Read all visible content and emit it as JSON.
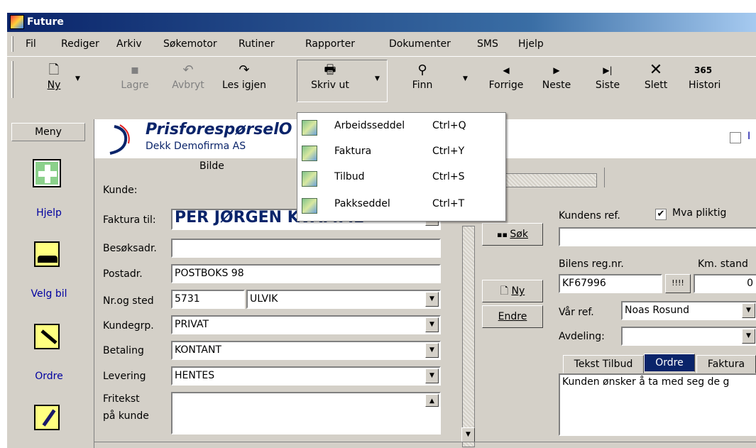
{
  "window": {
    "title": "Future"
  },
  "menu": [
    "Fil",
    "Rediger",
    "Arkiv",
    "Søkemotor",
    "Rutiner",
    "Rapporter",
    "Dokumenter",
    "SMS",
    "Hjelp"
  ],
  "toolbar": {
    "ny": "Ny",
    "lagre": "Lagre",
    "avbryt": "Avbryt",
    "les_igjen": "Les igjen",
    "skriv_ut": "Skriv ut",
    "finn": "Finn",
    "forrige": "Forrige",
    "neste": "Neste",
    "siste": "Siste",
    "slett": "Slett",
    "historikk": "Histori",
    "historikk_badge": "365"
  },
  "print_menu": [
    {
      "label": "Arbeidsseddel",
      "shortcut": "Ctrl+Q"
    },
    {
      "label": "Faktura",
      "shortcut": "Ctrl+Y"
    },
    {
      "label": "Tilbud",
      "shortcut": "Ctrl+S"
    },
    {
      "label": "Pakkseddel",
      "shortcut": "Ctrl+T"
    }
  ],
  "left_nav": {
    "meny": "Meny",
    "hjelp": "Hjelp",
    "velg_bil": "Velg bil",
    "ordre": "Ordre"
  },
  "header": {
    "title": "PrisforespørselO",
    "company": "Dekk Demofirma AS",
    "checkbox_label": "I"
  },
  "form": {
    "bilde": "Bilde",
    "kunde_label": "Kunde:",
    "faktura_til_label": "Faktura til:",
    "faktura_til_value": "PER JØRGEN KVAMME",
    "besoksadr_label": "Besøksadr.",
    "besoksadr_value": "",
    "postadr_label": "Postadr.",
    "postadr_value": "POSTBOKS 98",
    "nr_sted_label": "Nr.og sted",
    "postnr_value": "5731",
    "sted_value": "ULVIK",
    "kundegrp_label": "Kundegrp.",
    "kundegrp_value": "PRIVAT",
    "betaling_label": "Betaling",
    "betaling_value": "KONTANT",
    "levering_label": "Levering",
    "levering_value": "HENTES",
    "fritekst_label_1": "Fritekst",
    "fritekst_label_2": "på kunde"
  },
  "buttons": {
    "sok": "Søk",
    "ny": "Ny",
    "endre": "Endre"
  },
  "right": {
    "kundens_ref_label": "Kundens ref.",
    "mva_label": "Mva pliktig",
    "mva_checked": true,
    "bilens_reg_label": "Bilens reg.nr.",
    "km_stand_label": "Km. stand",
    "reg_value": "KF67996",
    "reg_btn": "!!!!",
    "km_value": "0",
    "var_ref_label": "Vår ref.",
    "var_ref_value": "Noas Rosund",
    "avdeling_label": "Avdeling:",
    "tabs": [
      "Tekst Tilbud",
      "Ordre",
      "Faktura"
    ],
    "active_tab": "Ordre",
    "memo": "Kunden ønsker å ta med seg de g"
  }
}
